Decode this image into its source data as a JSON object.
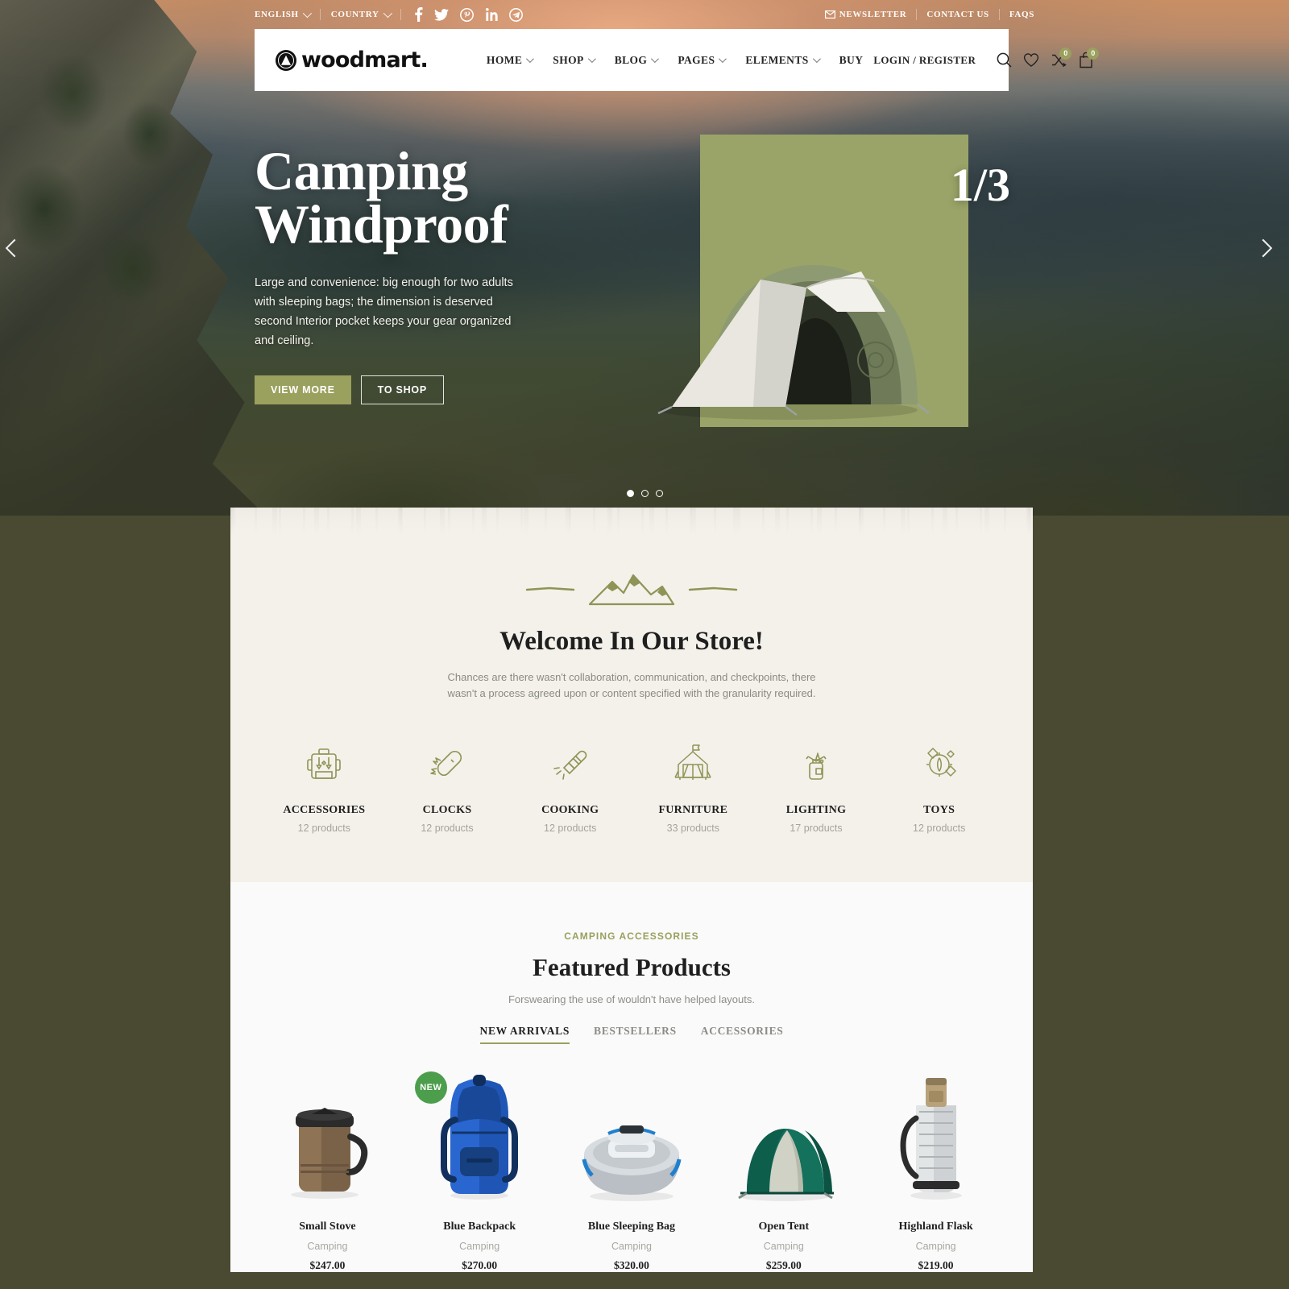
{
  "topbar": {
    "language": "ENGLISH",
    "country": "COUNTRY",
    "socials": [
      "facebook-icon",
      "twitter-icon",
      "pinterest-icon",
      "linkedin-icon",
      "telegram-icon"
    ],
    "newsletter": "NEWSLETTER",
    "contact": "CONTACT US",
    "faqs": "FAQS"
  },
  "header": {
    "logo_text": "woodmart.",
    "nav": [
      {
        "label": "HOME",
        "has_caret": true
      },
      {
        "label": "SHOP",
        "has_caret": true
      },
      {
        "label": "BLOG",
        "has_caret": true
      },
      {
        "label": "PAGES",
        "has_caret": true
      },
      {
        "label": "ELEMENTS",
        "has_caret": true
      },
      {
        "label": "BUY",
        "has_caret": false
      }
    ],
    "login": "LOGIN / REGISTER",
    "compare_count": "0",
    "cart_count": "0"
  },
  "hero": {
    "title_line1": "Camping",
    "title_line2": "Windproof",
    "description": "Large and convenience: big enough for two adults with sleeping bags; the dimension is deserved second Interior pocket keeps your gear organized and ceiling.",
    "btn_primary": "VIEW MORE",
    "btn_secondary": "TO SHOP",
    "slide_counter": "1/3",
    "accent_color": "#9aa468"
  },
  "welcome": {
    "title": "Welcome In Our Store!",
    "subtitle": "Chances are there wasn't collaboration, communication, and checkpoints, there wasn't a process agreed upon or content specified with the granularity required.",
    "categories": [
      {
        "icon": "backpack-icon",
        "name": "ACCESSORIES",
        "count": "12 products"
      },
      {
        "icon": "pocket-knife-icon",
        "name": "CLOCKS",
        "count": "12 products"
      },
      {
        "icon": "flashlight-icon",
        "name": "COOKING",
        "count": "12 products"
      },
      {
        "icon": "tent-icon",
        "name": "FURNITURE",
        "count": "33 products"
      },
      {
        "icon": "camp-stove-icon",
        "name": "LIGHTING",
        "count": "17 products"
      },
      {
        "icon": "compass-icon",
        "name": "TOYS",
        "count": "12 products"
      }
    ]
  },
  "featured": {
    "eyebrow": "CAMPING ACCESSORIES",
    "title": "Featured Products",
    "subtitle": "Forswearing the use of wouldn't have helped layouts.",
    "tabs": [
      {
        "label": "NEW ARRIVALS",
        "active": true
      },
      {
        "label": "BESTSELLERS",
        "active": false
      },
      {
        "label": "ACCESSORIES",
        "active": false
      }
    ],
    "products": [
      {
        "name": "Small Stove",
        "category": "Camping",
        "price": "$247.00",
        "badge": null
      },
      {
        "name": "Blue Backpack",
        "category": "Camping",
        "price": "$270.00",
        "badge": "NEW"
      },
      {
        "name": "Blue Sleeping Bag",
        "category": "Camping",
        "price": "$320.00",
        "badge": null
      },
      {
        "name": "Open Tent",
        "category": "Camping",
        "price": "$259.00",
        "badge": null
      },
      {
        "name": "Highland Flask",
        "category": "Camping",
        "price": "$219.00",
        "badge": null
      }
    ]
  }
}
